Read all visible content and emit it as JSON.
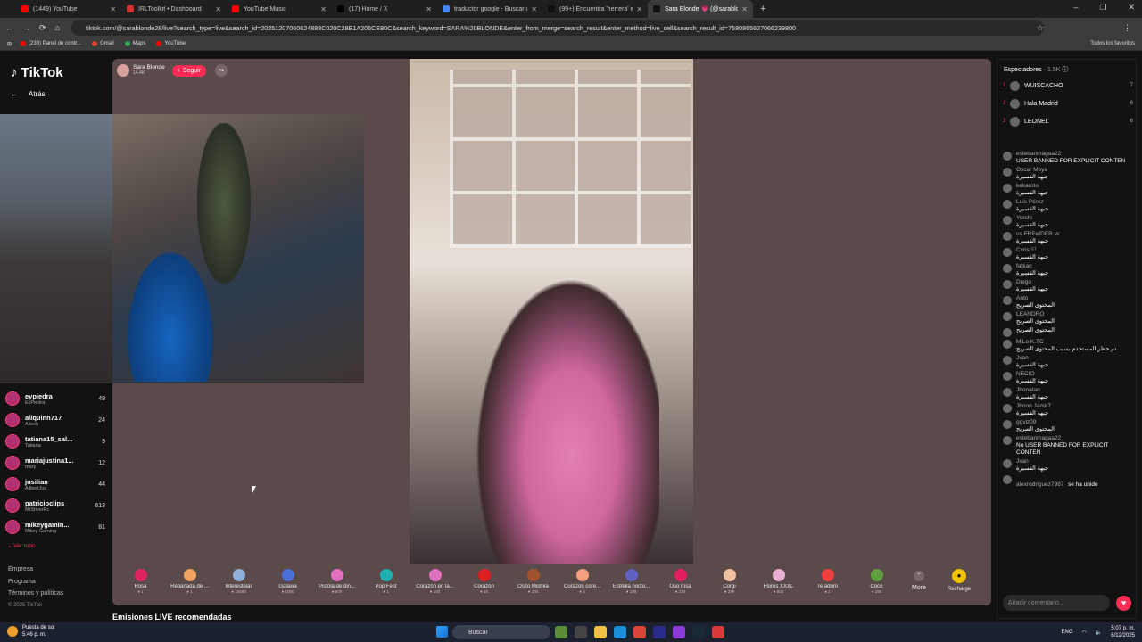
{
  "tabs": [
    {
      "title": "(1449) YouTube",
      "color": "#ff0000"
    },
    {
      "title": "IRLToolkit • Dashboard",
      "color": "#d32f2f"
    },
    {
      "title": "YouTube Music",
      "color": "#ff0000"
    },
    {
      "title": "(17) Home / X",
      "color": "#000000"
    },
    {
      "title": "traductor google - Buscar con G",
      "color": "#4285f4"
    },
    {
      "title": "(99+) Encuentra 'herrera' en Tik",
      "color": "#111111"
    },
    {
      "title": "Sara Blonde 💗 (@sarablo",
      "color": "#111111",
      "active": true
    }
  ],
  "url": "tiktok.com/@sarablonde28/live?search_type=live&search_id=20251207060624888C020C28E1A206CE80C&search_keyword=SARA%20BLONDE&enter_from_merge=search_result&enter_method=live_cell&search_result_id=7580865627066239800",
  "bookmarks": [
    {
      "label": "(238) Panel de contr...",
      "color": "#ff0000"
    },
    {
      "label": "Gmail",
      "color": "#ea4335"
    },
    {
      "label": "Maps",
      "color": "#34a853"
    },
    {
      "label": "YouTube",
      "color": "#ff0000"
    }
  ],
  "bookmarks_right": "Todos los favoritos",
  "sidebar": {
    "logo": "TikTok",
    "back": "Atrás",
    "followed": [
      {
        "name": "eypiedra",
        "sub": "EyPiedra",
        "count": "48"
      },
      {
        "name": "aliquinn717",
        "sub": "Alison",
        "count": "24"
      },
      {
        "name": "tatiana15_sal...",
        "sub": "Tatiana",
        "count": "9"
      },
      {
        "name": "mariajustina1...",
        "sub": "mary",
        "count": "12"
      },
      {
        "name": "jusilian",
        "sub": "AllbertJus",
        "count": "44"
      },
      {
        "name": "patricioclips_",
        "sub": "MrStiverRc",
        "count": "613"
      },
      {
        "name": "mikeygamin...",
        "sub": "Mikey Gaming",
        "count": "81"
      }
    ],
    "ver_todo": "Ver todo",
    "footer": [
      "Empresa",
      "Programa",
      "Términos y políticas"
    ],
    "copyright": "© 2025 TikTok"
  },
  "host": {
    "name": "Sara Blonde",
    "likes": "14.4K",
    "follow": "+ Seguir"
  },
  "gifts": [
    {
      "name": "Rosa",
      "price": "1",
      "color": "#e0245e"
    },
    {
      "name": "Rebanada de ...",
      "price": "1",
      "color": "#f4a460"
    },
    {
      "name": "Interestelar",
      "price": "10000",
      "color": "#8fb0d8"
    },
    {
      "name": "Galaxia",
      "price": "1000",
      "color": "#4a6fd8"
    },
    {
      "name": "Pistola de din...",
      "price": "500",
      "color": "#e070c0"
    },
    {
      "name": "Pop Fest",
      "price": "1",
      "color": "#20b0b0"
    },
    {
      "name": "Corazón en la...",
      "price": "100",
      "color": "#e070c0"
    },
    {
      "name": "Corazón",
      "price": "10",
      "color": "#e02020"
    },
    {
      "name": "Osito Mishka",
      "price": "100",
      "color": "#a0522d"
    },
    {
      "name": "Corazón core...",
      "price": "5",
      "color": "#f4a080"
    },
    {
      "name": "Estrella noctu...",
      "price": "199",
      "color": "#6060c0"
    },
    {
      "name": "Oso rosa",
      "price": "214",
      "color": "#e02060"
    },
    {
      "name": "Corgi",
      "price": "299",
      "color": "#f0c0a0"
    },
    {
      "name": "Flores XXXL",
      "price": "500",
      "color": "#e8b0d0"
    },
    {
      "name": "Te adoro",
      "price": "1",
      "color": "#f04040"
    },
    {
      "name": "Coco",
      "price": "199",
      "color": "#60a040"
    }
  ],
  "more_label": "More",
  "recharge_label": "Recharge",
  "recommended": "Emisiones LIVE recomendadas",
  "chat": {
    "viewers_label": "Espectadores",
    "viewers_count": "1.5K",
    "top": [
      {
        "rank": "1",
        "name": "WUISCACHO",
        "score": "7"
      },
      {
        "rank": "2",
        "name": "Hala Madrid",
        "score": "6"
      },
      {
        "rank": "3",
        "name": "LEONEL",
        "score": "6"
      }
    ],
    "messages": [
      {
        "user": "estebanmagaa22",
        "text": "USER BANNED FOR EXPLICIT CONTEN"
      },
      {
        "user": "Oscar Moya",
        "text": "جبهة الفسيرة"
      },
      {
        "user": "kakaroto",
        "text": "جبهة الفسيرة"
      },
      {
        "user": "Luis Pérez",
        "text": "جبهة الفسيرة"
      },
      {
        "user": "Yorchi",
        "text": "جبهة الفسيرة"
      },
      {
        "user": "us FREeIDER vε",
        "text": "جبهة الفسيرة"
      },
      {
        "user": "Cxris ᴳᵀ",
        "text": "جبهة الفسيرة"
      },
      {
        "user": "fabian",
        "text": "جبهة الفسيرة"
      },
      {
        "user": "Diego",
        "text": "جبهة الفسيرة"
      },
      {
        "user": "Anto",
        "text": "المحتوى الصريح"
      },
      {
        "user": "LEANDRO",
        "text": "المحتوى الصريح"
      },
      {
        "user": "",
        "text": "المحتوى الصريح"
      },
      {
        "user": "MiLo.K.TC",
        "text": "تم حظر المستخدم بسبب المحتوى الصريح"
      },
      {
        "user": "Jxan",
        "text": "جبهة الفسيرة"
      },
      {
        "user": "NECIO",
        "text": "جبهة الفسيرة"
      },
      {
        "user": "Jhonatan",
        "text": "جبهة الفسيرة"
      },
      {
        "user": "Jhoon Jamir7",
        "text": "جبهة الفسيرة"
      },
      {
        "user": "ggvlz09",
        "text": "المحتوى الصريح"
      },
      {
        "user": "estebanmagaa22",
        "text": "No USER BANNED FOR EXPLICIT CONTEN"
      },
      {
        "user": "Jxan",
        "text": "جبهة الفسيرة"
      }
    ],
    "last": {
      "user": "alexrodriguez7987",
      "text": "se ha unido"
    },
    "input_placeholder": "Añadir comentario..."
  },
  "taskbar": {
    "weather_title": "Puesta de sol",
    "weather_time": "5:46 p. m.",
    "search": "Buscar",
    "lang": "ENG",
    "time": "5:07 p. m.",
    "date": "6/12/2025"
  }
}
